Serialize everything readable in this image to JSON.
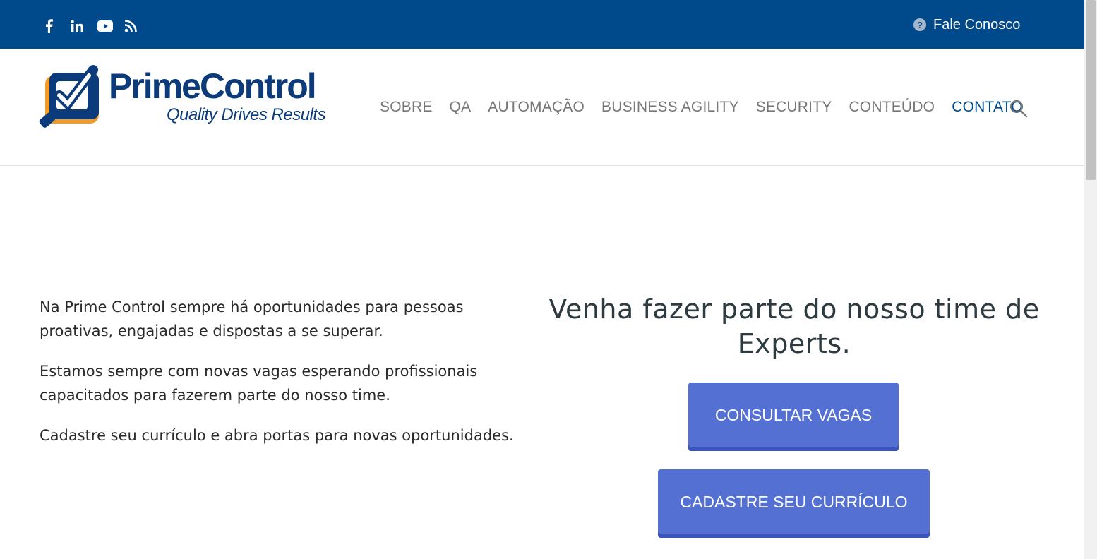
{
  "topbar": {
    "social": [
      {
        "icon": "facebook-icon",
        "glyph": "f"
      },
      {
        "icon": "linkedin-icon",
        "glyph": "in"
      },
      {
        "icon": "youtube-icon",
        "glyph": "▶"
      },
      {
        "icon": "rss-icon",
        "glyph": "rss"
      }
    ],
    "contact_label": "Fale Conosco",
    "contact_icon": "question-circle-icon",
    "bg_color": "#004a8c"
  },
  "logo": {
    "name": "PrimeControl",
    "tagline": "Quality Drives Results"
  },
  "nav": {
    "items": [
      {
        "label": "SOBRE"
      },
      {
        "label": "QA"
      },
      {
        "label": "AUTOMAÇÃO"
      },
      {
        "label": "BUSINESS AGILITY"
      },
      {
        "label": "SECURITY"
      },
      {
        "label": "CONTEÚDO"
      },
      {
        "label": "CONTATO",
        "active": true
      }
    ],
    "search_icon": "search-icon"
  },
  "intro": {
    "paragraphs": [
      "Na Prime Control sempre há oportunidades para pessoas proativas, engajadas e dispostas a se superar.",
      "Estamos sempre com novas vagas esperando profissionais capacitados para fazerem parte do nosso time.",
      "Cadastre seu currículo e abra portas para novas oportunidades."
    ]
  },
  "cta": {
    "title": "Venha fazer parte do nosso time de Experts.",
    "buttons": {
      "vagas": "CONSULTAR VAGAS",
      "curriculo": "CADASTRE SEU CURRÍCULO"
    },
    "button_color": "#5570d3"
  }
}
